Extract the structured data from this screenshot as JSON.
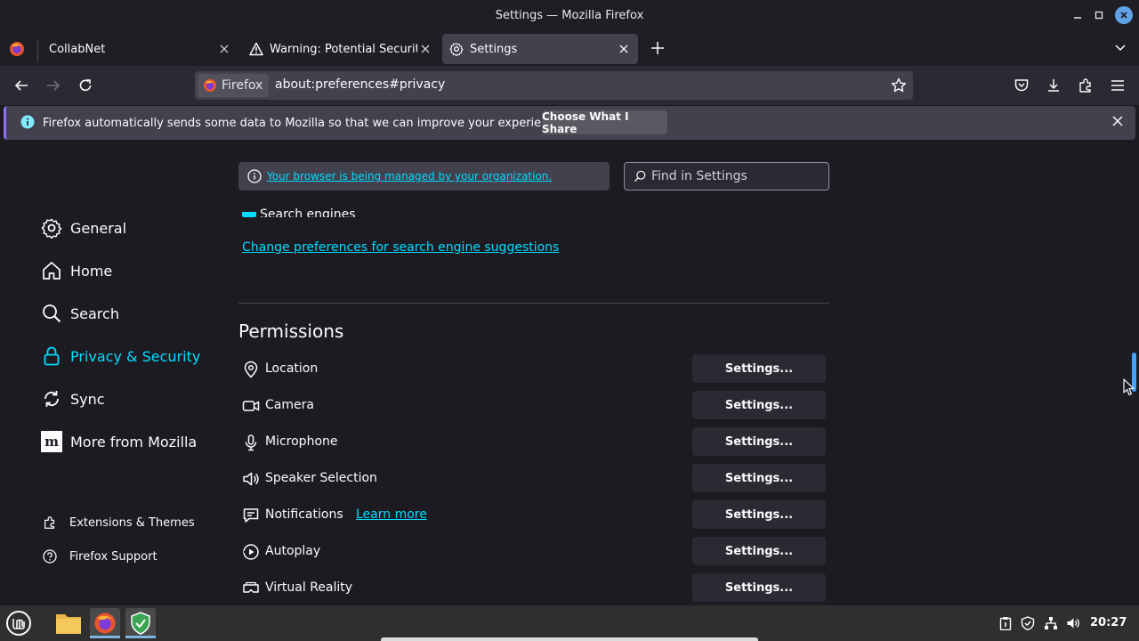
{
  "window": {
    "title": "Settings — Mozilla Firefox"
  },
  "tabs": [
    {
      "label": "CollabNet"
    },
    {
      "label": "Warning: Potential Security"
    },
    {
      "label": "Settings"
    }
  ],
  "urlbar": {
    "identity_label": "Firefox",
    "url": "about:preferences#privacy"
  },
  "notification": {
    "text": "Firefox automatically sends some data to Mozilla so that we can improve your experience.",
    "button": "Choose What I Share"
  },
  "sidebar": {
    "items": [
      {
        "label": "General",
        "icon": "gear-icon"
      },
      {
        "label": "Home",
        "icon": "home-icon"
      },
      {
        "label": "Search",
        "icon": "search-icon"
      },
      {
        "label": "Privacy & Security",
        "icon": "lock-icon",
        "selected": true
      },
      {
        "label": "Sync",
        "icon": "sync-icon"
      },
      {
        "label": "More from Mozilla",
        "icon": "mozilla-icon"
      }
    ],
    "footer": [
      {
        "label": "Extensions & Themes",
        "icon": "puzzle-icon"
      },
      {
        "label": "Firefox Support",
        "icon": "help-icon"
      }
    ]
  },
  "managed_notice": "Your browser is being managed by your organization.",
  "find": {
    "placeholder": "Find in Settings"
  },
  "search_suggestions": {
    "partial_label": "Search engines",
    "change_link": "Change preferences for search engine suggestions"
  },
  "permissions": {
    "title": "Permissions",
    "button_label": "Settings...",
    "rows": [
      {
        "label": "Location",
        "icon": "location-icon"
      },
      {
        "label": "Camera",
        "icon": "camera-icon"
      },
      {
        "label": "Microphone",
        "icon": "microphone-icon"
      },
      {
        "label": "Speaker Selection",
        "icon": "speaker-icon"
      },
      {
        "label": "Notifications",
        "icon": "notification-icon",
        "link": "Learn more"
      },
      {
        "label": "Autoplay",
        "icon": "autoplay-icon"
      },
      {
        "label": "Virtual Reality",
        "icon": "vr-icon"
      }
    ]
  },
  "taskbar": {
    "clock": "20:27"
  },
  "colors": {
    "accent": "#00ddff",
    "background": "#1c1b22",
    "button": "#2b2a33"
  }
}
